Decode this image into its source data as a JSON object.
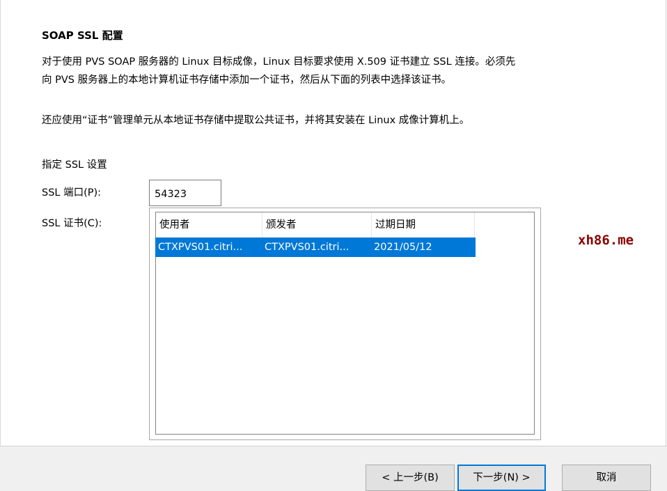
{
  "page": {
    "title": "SOAP SSL 配置",
    "description_line1": "对于使用 PVS SOAP 服务器的 Linux 目标成像，Linux 目标要求使用 X.509 证书建立 SSL 连接。必须先",
    "description_line2": "向 PVS 服务器上的本地计算机证书存储中添加一个证书，然后从下面的列表中选择该证书。",
    "note": "还应使用“证书”管理单元从本地证书存储中提取公共证书，并将其安装在 Linux 成像计算机上。"
  },
  "ssl": {
    "section_label": "指定 SSL 设置",
    "port_label": "SSL 端口(P):",
    "port_value": "54323",
    "cert_label": "SSL 证书(C):",
    "columns": [
      "使用者",
      "颁发者",
      "过期日期"
    ],
    "rows": [
      {
        "subject": "CTXPVS01.citri...",
        "issuer": "CTXPVS01.citri...",
        "expires": "2021/05/12",
        "selected": true
      }
    ]
  },
  "watermark": "xh86.me",
  "buttons": {
    "back": "< 上一步(B)",
    "next": "下一步(N) >",
    "cancel": "取消"
  },
  "colors": {
    "selection": "#0078d7",
    "watermark": "#8b0000",
    "footer_bg": "#f0f0f0",
    "button_bg": "#e1e1e1"
  }
}
